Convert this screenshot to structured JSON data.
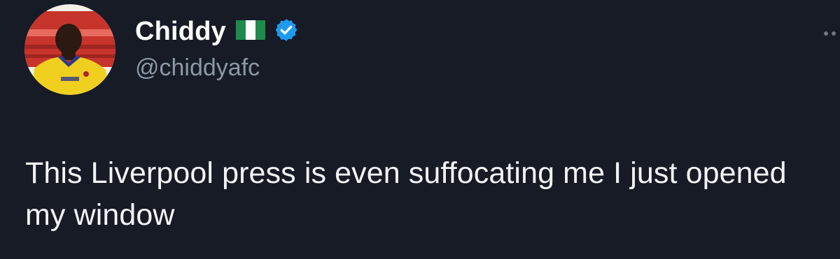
{
  "tweet": {
    "author": {
      "display_name": "Chiddy",
      "handle": "@chiddyafc",
      "flag_icon": "nigeria-flag-icon",
      "verified_icon": "verified-badge-icon",
      "verified_color": "#1d9bf0"
    },
    "text": "This Liverpool press is even suffocating me I just opened my window",
    "more_icon": "more-options-icon"
  },
  "colors": {
    "background": "#161b26",
    "name": "#ffffff",
    "handle": "#8b98a5",
    "text": "#f2f4f5"
  }
}
